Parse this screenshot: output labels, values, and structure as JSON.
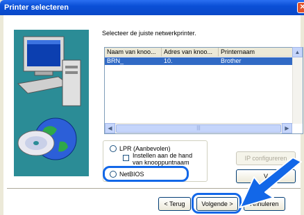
{
  "window": {
    "title": "Printer selecteren",
    "close_glyph": "✕"
  },
  "instruction": "Selecteer de juiste netwerkprinter.",
  "list": {
    "columns": [
      "Naam van knoo...",
      "Adres van knoo...",
      "Printernaam"
    ],
    "rows": [
      [
        "BRN_",
        "10.",
        "Brother"
      ]
    ],
    "scroll_up": "▲",
    "scroll_left": "◀",
    "scroll_right": "▶",
    "thumb_grip": "|||"
  },
  "options": {
    "lpr_label": "LPR (Aanbevolen)",
    "manual_label": "Instellen aan de hand van knooppuntnaam",
    "netbios_label": "NetBIOS"
  },
  "buttons": {
    "ip_config": "IP configureren",
    "view": "V",
    "back": "< Terug",
    "next": "Volgende >",
    "cancel": "Annuleren"
  },
  "colors": {
    "title_bar": "#0a4fd6",
    "highlight": "#1267e8",
    "selection": "#316ac5",
    "art_bg": "#2b8c96"
  },
  "icons": [
    "computer-icon",
    "globe-icon",
    "cd-icon",
    "pointer-arrow-icon"
  ]
}
